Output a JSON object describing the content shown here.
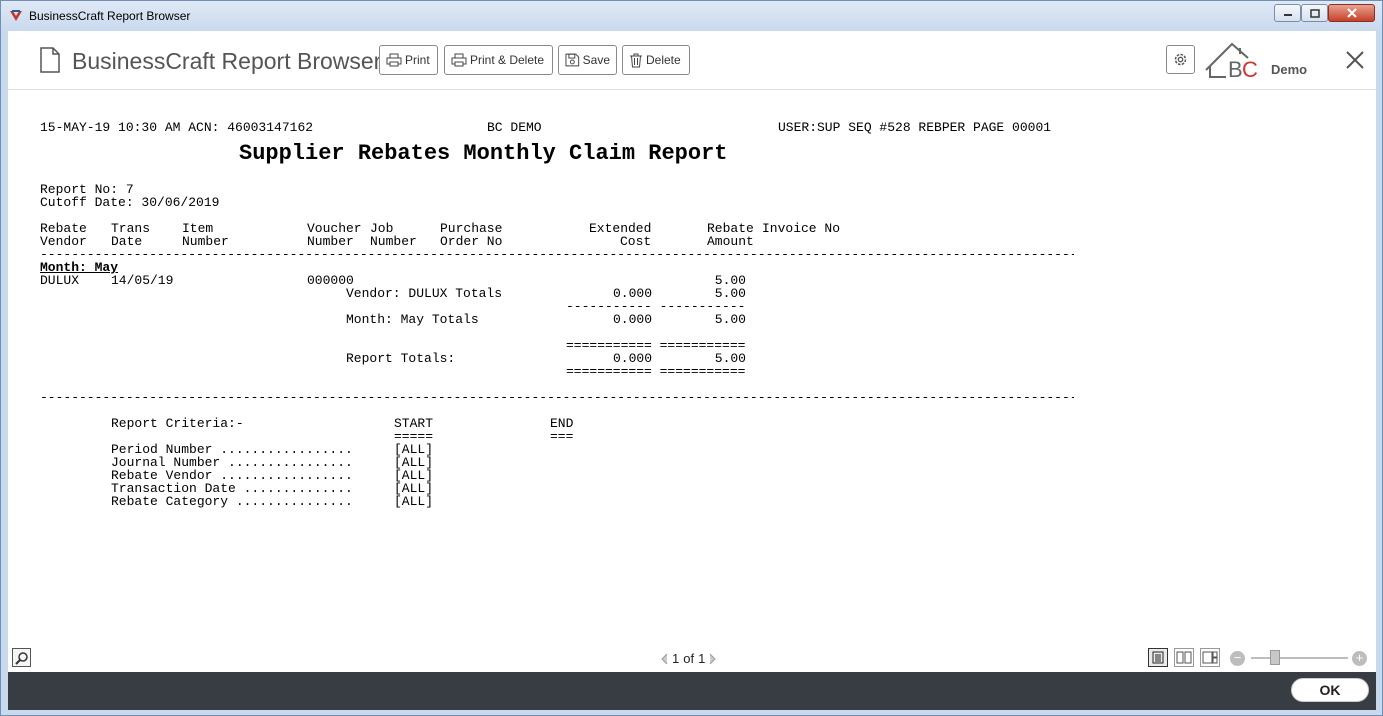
{
  "window": {
    "title": "BusinessCraft Report Browser",
    "accent": "#c9d9ee"
  },
  "header": {
    "app_name": "BusinessCraft Report Browser",
    "buttons": {
      "print": "Print",
      "print_delete": "Print & Delete",
      "save": "Save",
      "delete": "Delete"
    },
    "logo_demo": "Demo"
  },
  "report": {
    "top_left": "15-MAY-19 10:30 AM ACN: 46003147162",
    "top_center": "BC DEMO",
    "top_right": "USER:SUP SEQ #528 REBPER PAGE 00001",
    "title": "Supplier Rebates Monthly Claim Report",
    "report_no": "Report No: 7",
    "cutoff": "Cutoff Date: 30/06/2019",
    "columns": {
      "c1a": "Rebate",
      "c1b": "Vendor",
      "c2a": "Trans",
      "c2b": "Date",
      "c3a": "Item",
      "c3b": "Number",
      "c4a": "Voucher",
      "c4b": "Number",
      "c5a": "Job",
      "c5b": "Number",
      "c6a": "Purchase",
      "c6b": "Order No",
      "c7a": "Extended",
      "c7b": "Cost",
      "c8a": "Rebate",
      "c8b": "Amount",
      "c9a": "Invoice No"
    },
    "dash_line": "-------------------------------------------------------------------------------------------------------------------------------------------------------------------",
    "month_label": "Month: May",
    "row": {
      "vendor": "DULUX",
      "date": "14/05/19",
      "voucher": "000000",
      "amount": "5.00"
    },
    "vendor_totals": {
      "label": "Vendor: DULUX Totals",
      "cost": "0.000",
      "amount": "5.00"
    },
    "single_underline": "----------- -----------",
    "month_totals": {
      "label": "Month: May Totals",
      "cost": "0.000",
      "amount": "5.00"
    },
    "double_underline": "=========== ===========",
    "report_totals": {
      "label": "Report Totals:",
      "cost": "0.000",
      "amount": "5.00"
    },
    "criteria": {
      "heading": "Report Criteria:-",
      "start": "START",
      "start_ul": "=====",
      "end": "END",
      "end_ul": "===",
      "items": [
        {
          "label": "Period Number .................",
          "value": "[ALL]"
        },
        {
          "label": "Journal Number ................",
          "value": "[ALL]"
        },
        {
          "label": "Rebate Vendor .................",
          "value": "[ALL]"
        },
        {
          "label": "Transaction Date ..............",
          "value": "[ALL]"
        },
        {
          "label": "Rebate Category ...............",
          "value": "[ALL]"
        }
      ]
    }
  },
  "statusbar": {
    "page_current": "1",
    "page_of": "of",
    "page_total": "1"
  },
  "footer": {
    "ok": "OK"
  }
}
